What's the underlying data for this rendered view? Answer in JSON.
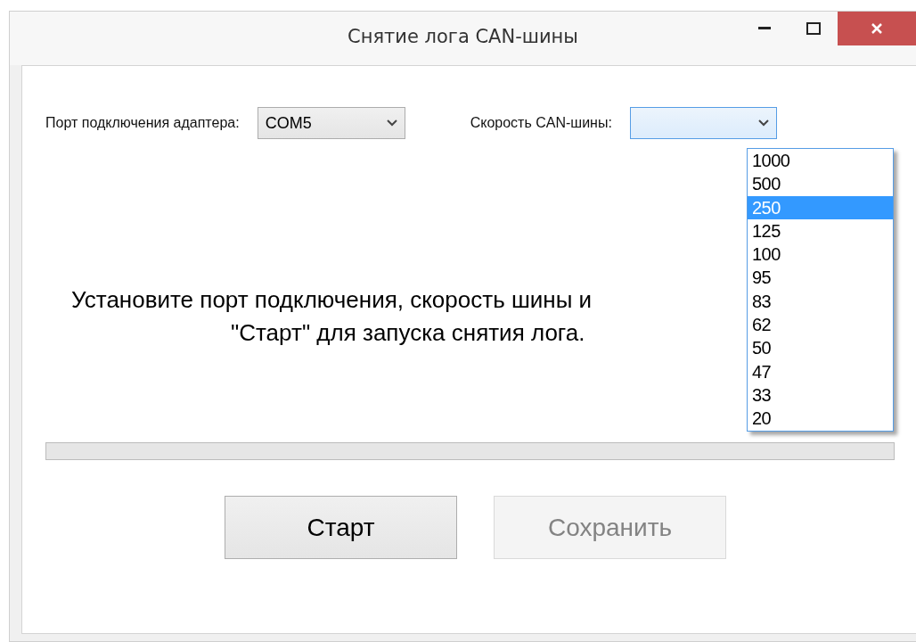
{
  "window": {
    "title": "Снятие лога CAN-шины"
  },
  "port": {
    "label": "Порт подключения адаптера:",
    "value": "COM5"
  },
  "speed": {
    "label": "Скорость CAN-шины:",
    "expanded": true,
    "options": [
      {
        "label": "1000",
        "selected": false
      },
      {
        "label": "500",
        "selected": false
      },
      {
        "label": "250",
        "selected": true
      },
      {
        "label": "125",
        "selected": false
      },
      {
        "label": "100",
        "selected": false
      },
      {
        "label": "95",
        "selected": false
      },
      {
        "label": "83",
        "selected": false
      },
      {
        "label": "62",
        "selected": false
      },
      {
        "label": "50",
        "selected": false
      },
      {
        "label": "47",
        "selected": false
      },
      {
        "label": "33",
        "selected": false
      },
      {
        "label": "20",
        "selected": false
      }
    ]
  },
  "message": [
    "Установите порт подключения, скорость шины и",
    "\"Старт\" для запуска снятия лога."
  ],
  "progress": {
    "level": 0
  },
  "buttons": [
    {
      "label": "Старт",
      "disabled": false
    },
    {
      "label": "Сохранить",
      "disabled": true
    }
  ]
}
